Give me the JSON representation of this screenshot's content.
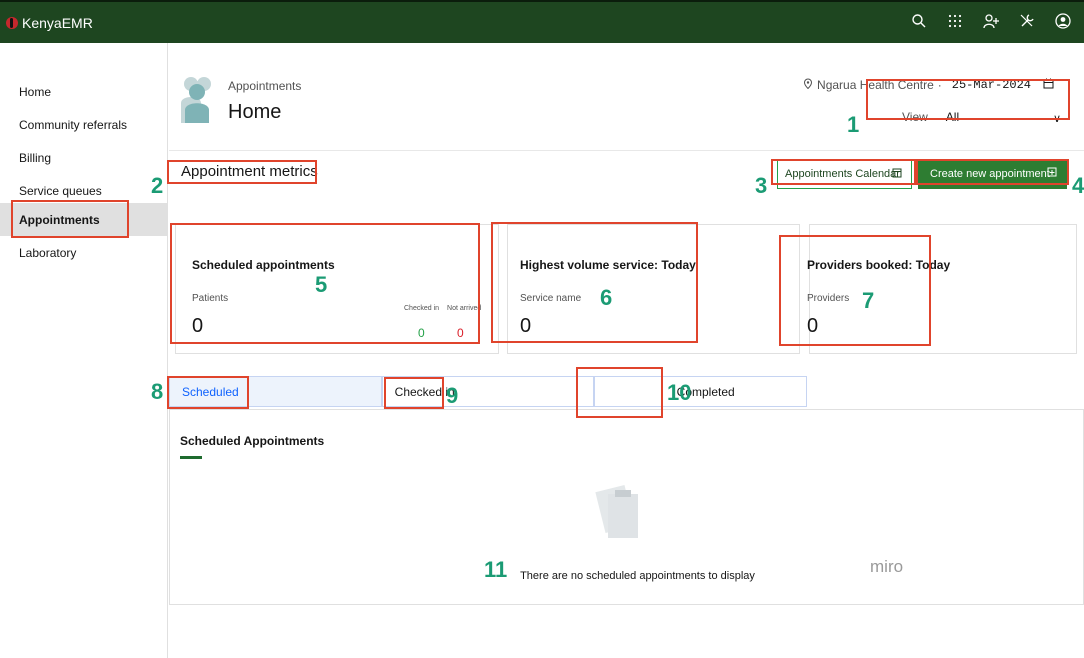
{
  "app": {
    "name": "KenyaEMR"
  },
  "topbar": {
    "icons": [
      "search-icon",
      "app-switcher-icon",
      "add-patient-icon",
      "tools-icon",
      "user-avatar-icon"
    ]
  },
  "sidenav": {
    "items": [
      {
        "label": "Home",
        "active": false
      },
      {
        "label": "Community referrals",
        "active": false
      },
      {
        "label": "Billing",
        "active": false
      },
      {
        "label": "Service queues",
        "active": false
      },
      {
        "label": "Appointments",
        "active": true
      },
      {
        "label": "Laboratory",
        "active": false
      }
    ]
  },
  "header": {
    "subtitle": "Appointments",
    "title": "Home",
    "location": "Ngarua Health Centre",
    "separator": "·",
    "date": "25-Mar-2024"
  },
  "view": {
    "label": "View",
    "value": "All"
  },
  "metrics": {
    "title": "Appointment metrics",
    "calendar_button": "Appointments Calendar",
    "create_button": "Create new appointment"
  },
  "cards": {
    "scheduled": {
      "title": "Scheduled appointments",
      "label": "Patients",
      "value": "0",
      "checked_in_label": "Checked in",
      "not_arrived_label": "Not arrived",
      "checked_in_value": "0",
      "not_arrived_value": "0"
    },
    "highest_volume": {
      "title": "Highest volume service: Today",
      "label": "Service name",
      "value": "0"
    },
    "providers": {
      "title": "Providers booked: Today",
      "label": "Providers",
      "value": "0"
    }
  },
  "tabs": [
    {
      "label": "Scheduled",
      "selected": true
    },
    {
      "label": "Checked in",
      "selected": false
    },
    {
      "label": "Completed",
      "selected": false
    }
  ],
  "panel": {
    "title": "Scheduled Appointments",
    "empty_message": "There are no scheduled appointments to display"
  },
  "annotations": [
    "1",
    "2",
    "3",
    "4",
    "5",
    "6",
    "7",
    "8",
    "9",
    "10",
    "11"
  ],
  "watermark": "miro",
  "colors": {
    "topbar": "#1e4620",
    "primary_button": "#2e7d32",
    "annotation_box": "#e0442c",
    "annotation_number": "#1b9b74"
  }
}
